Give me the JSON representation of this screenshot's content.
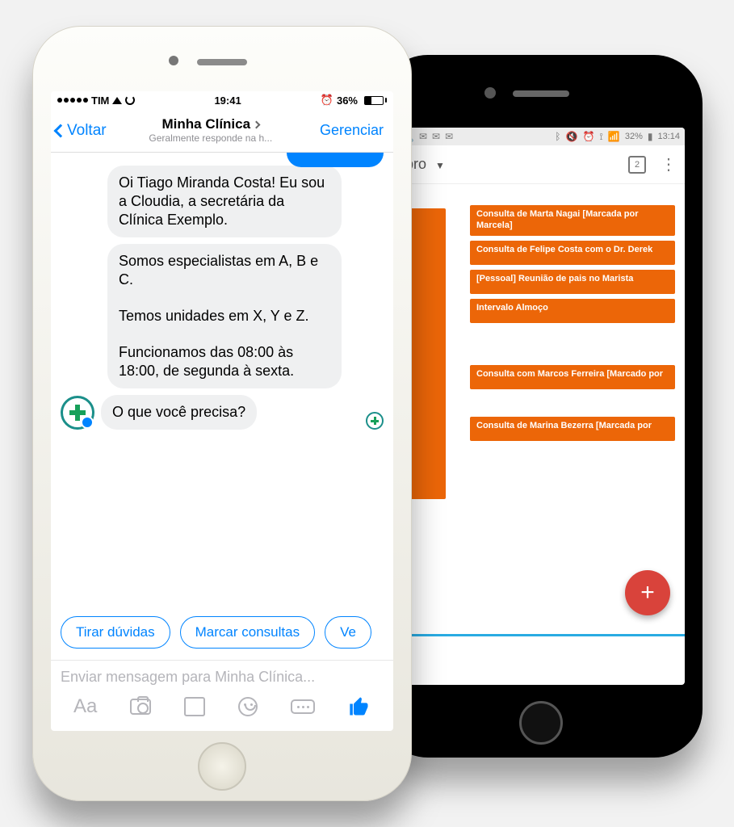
{
  "colors": {
    "accent_blue": "#0084ff",
    "orange": "#ec6608",
    "fab_red": "#d9433b"
  },
  "back_phone": {
    "status": {
      "icons_left": [
        "wrench-icon",
        "mail-icon",
        "mail-icon",
        "mail-icon"
      ],
      "icons_right": [
        "bluetooth-icon",
        "mute-icon",
        "alarm-icon",
        "location-icon",
        "signal-icon"
      ],
      "battery_pct": "32%",
      "time": "13:14"
    },
    "header": {
      "month_label": "bro",
      "day_number": "2"
    },
    "events": [
      {
        "text": "Consulta de Marta Nagai [Marcada por Marcela]"
      },
      {
        "text": "Consulta de Felipe Costa com o Dr. Derek"
      },
      {
        "text": "[Pessoal] Reunião de pais no Marista"
      },
      {
        "text": "Intervalo Almoço"
      },
      {
        "text": "Consulta com Marcos Ferreira [Marcado por"
      },
      {
        "text": "Consulta de Marina Bezerra [Marcada por"
      }
    ],
    "fab_label": "+"
  },
  "front_phone": {
    "status": {
      "carrier": "TIM",
      "time": "19:41",
      "alarm": true,
      "battery_pct": "36%"
    },
    "nav": {
      "back_label": "Voltar",
      "title": "Minha Clínica",
      "subtitle": "Geralmente responde na h...",
      "manage_label": "Gerenciar"
    },
    "messages": {
      "m1": "Oi Tiago Miranda Costa! Eu sou a Cloudia, a secretária da Clínica Exemplo.",
      "m2_p1": "Somos especialistas em A, B e C.",
      "m2_p2": "Temos unidades em X, Y e Z.",
      "m2_p3": "Funcionamos das 08:00 às 18:00, de segunda à sexta.",
      "m3": "O que você precisa?"
    },
    "quick_replies": {
      "q1": "Tirar dúvidas",
      "q2": "Marcar consultas",
      "q3": "Ve"
    },
    "composer": {
      "placeholder": "Enviar mensagem para Minha Clínica...",
      "aa_label": "Aa"
    }
  }
}
